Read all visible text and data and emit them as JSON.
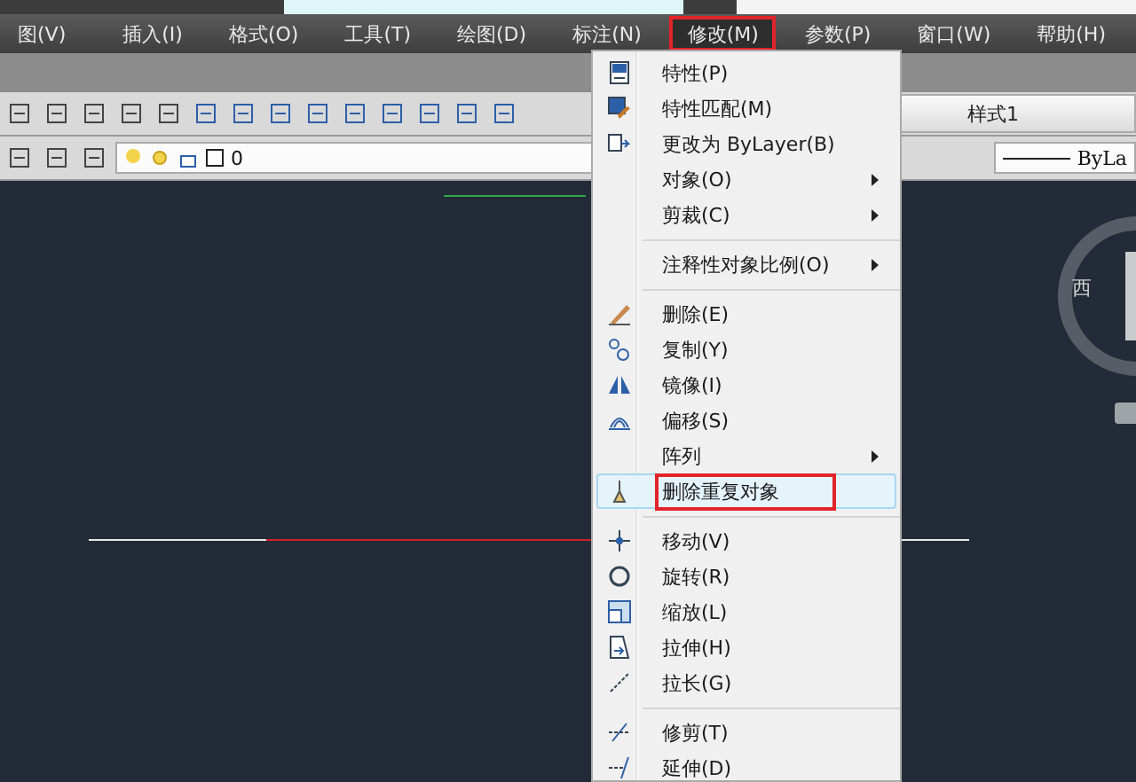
{
  "menubar": [
    {
      "label": "图(V)",
      "selected": false
    },
    {
      "label": "插入(I)",
      "selected": false
    },
    {
      "label": "格式(O)",
      "selected": false
    },
    {
      "label": "工具(T)",
      "selected": false
    },
    {
      "label": "绘图(D)",
      "selected": false
    },
    {
      "label": "标注(N)",
      "selected": false
    },
    {
      "label": "修改(M)",
      "selected": true
    },
    {
      "label": "参数(P)",
      "selected": false
    },
    {
      "label": "窗口(W)",
      "selected": false
    },
    {
      "label": "帮助(H)",
      "selected": false
    }
  ],
  "layer_toolbar": {
    "layer": "0",
    "linetype": "ByLa"
  },
  "style_toolbar": {
    "style": "样式1"
  },
  "menu": [
    {
      "kind": "item",
      "label": "特性(P)",
      "submenu": false,
      "selected": false
    },
    {
      "kind": "item",
      "label": "特性匹配(M)",
      "submenu": false,
      "selected": false
    },
    {
      "kind": "item",
      "label": "更改为 ByLayer(B)",
      "submenu": false,
      "selected": false
    },
    {
      "kind": "item",
      "label": "对象(O)",
      "submenu": true,
      "selected": false
    },
    {
      "kind": "item",
      "label": "剪裁(C)",
      "submenu": true,
      "selected": false
    },
    {
      "kind": "separator"
    },
    {
      "kind": "item",
      "label": "注释性对象比例(O)",
      "submenu": true,
      "selected": false
    },
    {
      "kind": "separator"
    },
    {
      "kind": "item",
      "label": "删除(E)",
      "submenu": false,
      "selected": false
    },
    {
      "kind": "item",
      "label": "复制(Y)",
      "submenu": false,
      "selected": false
    },
    {
      "kind": "item",
      "label": "镜像(I)",
      "submenu": false,
      "selected": false
    },
    {
      "kind": "item",
      "label": "偏移(S)",
      "submenu": false,
      "selected": false
    },
    {
      "kind": "item",
      "label": "阵列",
      "submenu": true,
      "selected": false
    },
    {
      "kind": "item",
      "label": "删除重复对象",
      "submenu": false,
      "selected": true
    },
    {
      "kind": "separator"
    },
    {
      "kind": "item",
      "label": "移动(V)",
      "submenu": false,
      "selected": false
    },
    {
      "kind": "item",
      "label": "旋转(R)",
      "submenu": false,
      "selected": false
    },
    {
      "kind": "item",
      "label": "缩放(L)",
      "submenu": false,
      "selected": false
    },
    {
      "kind": "item",
      "label": "拉伸(H)",
      "submenu": false,
      "selected": false
    },
    {
      "kind": "item",
      "label": "拉长(G)",
      "submenu": false,
      "selected": false
    },
    {
      "kind": "separator"
    },
    {
      "kind": "item",
      "label": "修剪(T)",
      "submenu": false,
      "selected": false
    },
    {
      "kind": "item",
      "label": "延伸(D)",
      "submenu": false,
      "selected": false
    }
  ],
  "viewcube": {
    "direction": "西"
  }
}
